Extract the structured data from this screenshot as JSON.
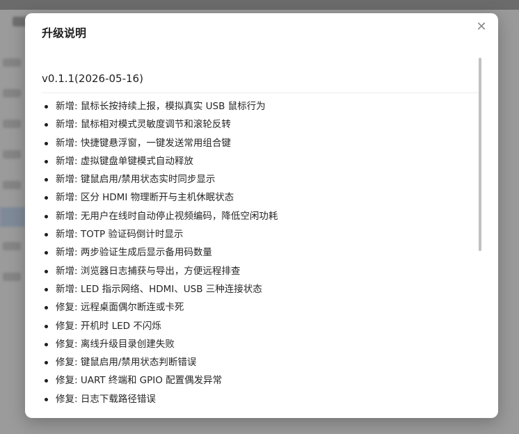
{
  "modal": {
    "title": "升级说明",
    "close_icon": "close-icon",
    "close_glyph": "✕"
  },
  "release": {
    "version_heading": "v0.1.1(2026-05-16)",
    "items": [
      {
        "label": "新增: 鼠标长按持续上报，模拟真实 USB 鼠标行为"
      },
      {
        "label": "新增: 鼠标相对模式灵敏度调节和滚轮反转"
      },
      {
        "label": "新增: 快捷键悬浮窗，一键发送常用组合键"
      },
      {
        "label": "新增: 虚拟键盘单键模式自动释放"
      },
      {
        "label": "新增: 键鼠启用/禁用状态实时同步显示"
      },
      {
        "label": "新增: 区分 HDMI 物理断开与主机休眠状态"
      },
      {
        "label": "新增: 无用户在线时自动停止视频编码，降低空闲功耗"
      },
      {
        "label": "新增: TOTP 验证码倒计时显示"
      },
      {
        "label": "新增: 两步验证生成后显示备用码数量"
      },
      {
        "label": "新增: 浏览器日志捕获与导出，方便远程排查"
      },
      {
        "label": "新增: LED 指示网络、HDMI、USB 三种连接状态"
      },
      {
        "label": "修复: 远程桌面偶尔断连或卡死"
      },
      {
        "label": "修复: 开机时 LED 不闪烁"
      },
      {
        "label": "修复: 离线升级目录创建失败"
      },
      {
        "label": "修复: 键鼠启用/禁用状态判断错误"
      },
      {
        "label": "修复: UART 终端和 GPIO 配置偶发异常"
      },
      {
        "label": "修复: 日志下载路径错误"
      }
    ]
  },
  "colors": {
    "overlay": "#9a9a9a",
    "modal_bg": "#ffffff",
    "text": "#262626",
    "divider": "#ececec",
    "scrollbar": "#c1c1c1"
  }
}
